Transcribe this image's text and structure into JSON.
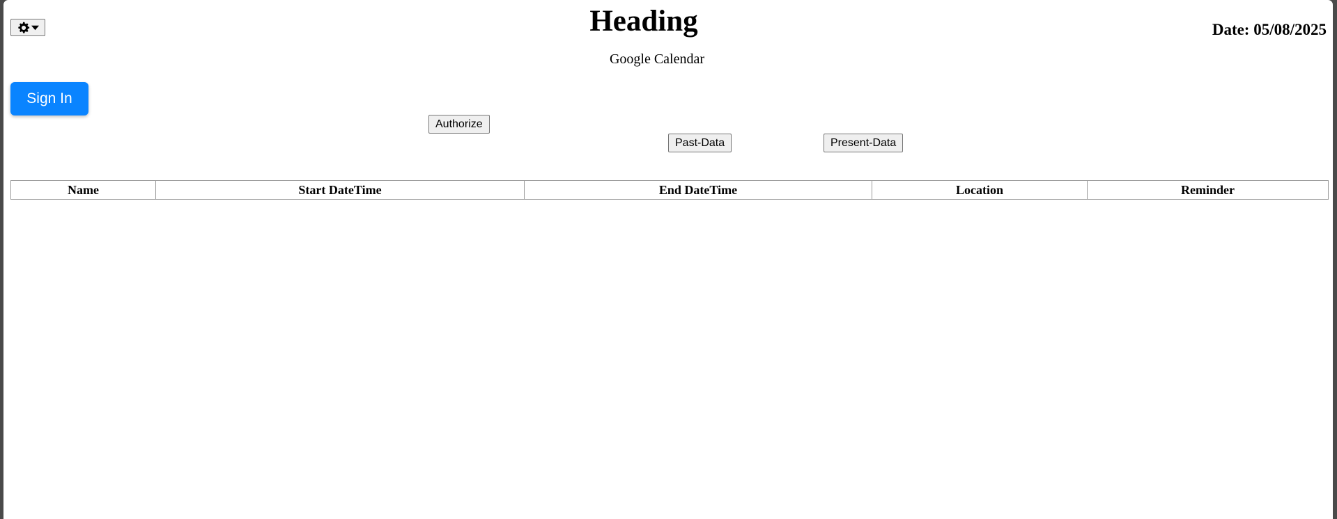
{
  "header": {
    "heading": "Heading",
    "date_label": "Date: 05/08/2025",
    "subtitle": "Google Calendar"
  },
  "toolbar": {
    "settings_icon": "gear-icon",
    "dropdown_icon": "caret-down-icon"
  },
  "buttons": {
    "sign_in": "Sign In",
    "authorize": "Authorize",
    "past_data": "Past-Data",
    "present_data": "Present-Data"
  },
  "table": {
    "columns": [
      "Name",
      "Start DateTime",
      "End DateTime",
      "Location",
      "Reminder"
    ],
    "rows": []
  },
  "colors": {
    "primary_button": "#0a84ff",
    "page_background": "#ffffff",
    "frame_background": "#4a4a4a"
  }
}
